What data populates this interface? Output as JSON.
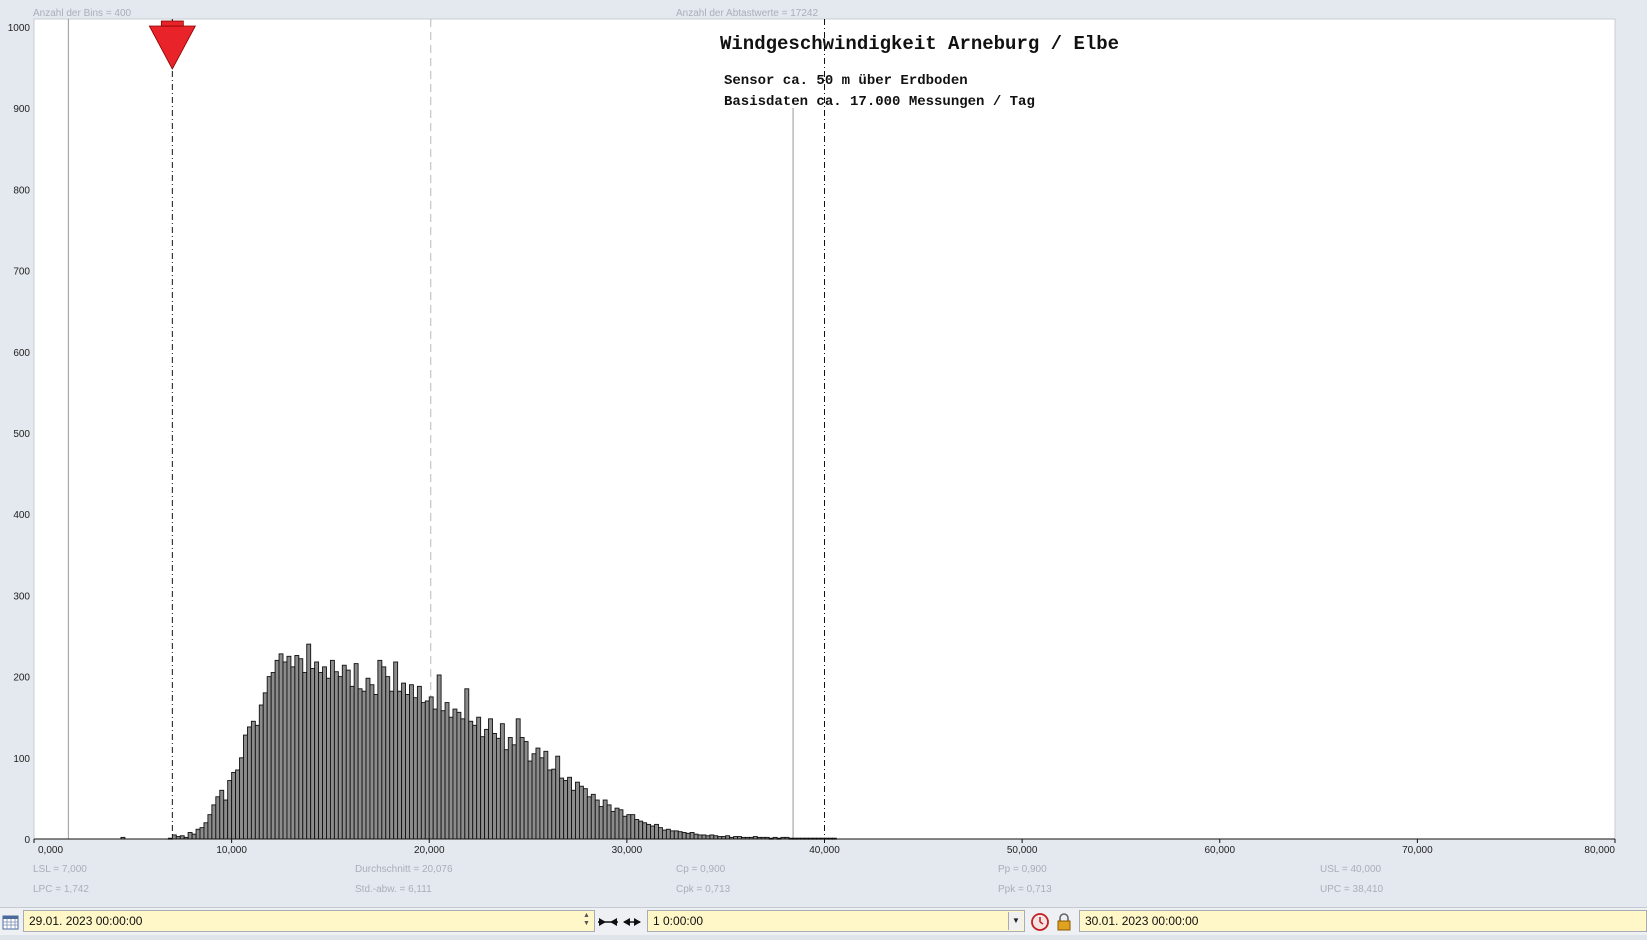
{
  "info": {
    "bins": "Anzahl der Bins =   400",
    "samples": "Anzahl der Abtastwerte = 17242"
  },
  "stats": {
    "lsl": "LSL = 7,000",
    "lpc": "LPC = 1,742",
    "mean": "Durchschnitt  = 20,076",
    "std": "Std.-abw. = 6,111",
    "cp": "Cp  = 0,900",
    "cpk": "Cpk = 0,713",
    "pp": "Pp  = 0,900",
    "ppk": "Ppk = 0,713",
    "usl": "USL = 40,000",
    "upc": "UPC = 38,410"
  },
  "toolbar": {
    "start_value": "29.01. 2023   00:00:00",
    "interval_value": "1 0:00:00",
    "end_value": "30.01. 2023   00:00:00"
  },
  "colors": {
    "bar_fill": "#8c8c8c",
    "bar_stroke": "#111111",
    "marker": "#e8242a",
    "field_bg": "#fff7c8",
    "background": "#e4e8ef"
  },
  "chart_data": {
    "type": "bar",
    "title": "Windgeschwindigkeit  Arneburg / Elbe",
    "annotation_lines": [
      "Sensor ca. 50 m über Erdboden",
      "Basisdaten ca. 17.000 Messungen / Tag"
    ],
    "xlim": [
      0,
      80000
    ],
    "ylim": [
      0,
      1000
    ],
    "x_ticks": [
      "0,000",
      "10,000",
      "20,000",
      "30,000",
      "40,000",
      "50,000",
      "60,000",
      "70,000",
      "80,000"
    ],
    "y_ticks": [
      "0",
      "100",
      "200",
      "300",
      "400",
      "500",
      "600",
      "700",
      "800",
      "900",
      "1000"
    ],
    "bin_width": 200,
    "bin_start": 4400,
    "values": [
      2,
      0,
      0,
      0,
      0,
      0,
      0,
      0,
      0,
      0,
      0,
      0,
      1,
      5,
      3,
      4,
      2,
      8,
      6,
      12,
      14,
      20,
      30,
      42,
      52,
      60,
      48,
      72,
      82,
      85,
      100,
      128,
      138,
      145,
      140,
      165,
      180,
      200,
      205,
      220,
      228,
      218,
      225,
      212,
      226,
      222,
      205,
      240,
      210,
      218,
      205,
      212,
      198,
      220,
      206,
      200,
      214,
      208,
      188,
      216,
      185,
      182,
      198,
      190,
      178,
      220,
      212,
      200,
      182,
      218,
      182,
      192,
      178,
      190,
      174,
      188,
      168,
      170,
      175,
      160,
      202,
      158,
      168,
      150,
      160,
      156,
      148,
      185,
      145,
      140,
      150,
      126,
      135,
      148,
      130,
      124,
      142,
      110,
      125,
      116,
      148,
      125,
      120,
      96,
      105,
      112,
      100,
      108,
      85,
      86,
      102,
      75,
      72,
      76,
      60,
      70,
      65,
      62,
      52,
      55,
      48,
      40,
      48,
      42,
      34,
      38,
      36,
      28,
      30,
      30,
      24,
      22,
      20,
      18,
      16,
      18,
      14,
      11,
      12,
      10,
      10,
      9,
      8,
      7,
      8,
      6,
      5,
      5,
      4,
      5,
      4,
      3,
      3,
      4,
      2,
      3,
      3,
      2,
      2,
      2,
      3,
      2,
      2,
      2,
      1,
      2,
      1,
      2,
      2,
      1,
      1,
      1,
      1,
      1,
      1,
      1,
      1,
      1,
      1,
      1,
      1
    ],
    "reference_lines": [
      {
        "x": 7000,
        "style": "dashdot"
      },
      {
        "x": 20076,
        "style": "dashed-light"
      },
      {
        "x": 38410,
        "style": "solid-gray"
      },
      {
        "x": 40000,
        "style": "dashdot"
      },
      {
        "x": 1742,
        "style": "solid-gray"
      }
    ],
    "marker_x": 7000
  }
}
